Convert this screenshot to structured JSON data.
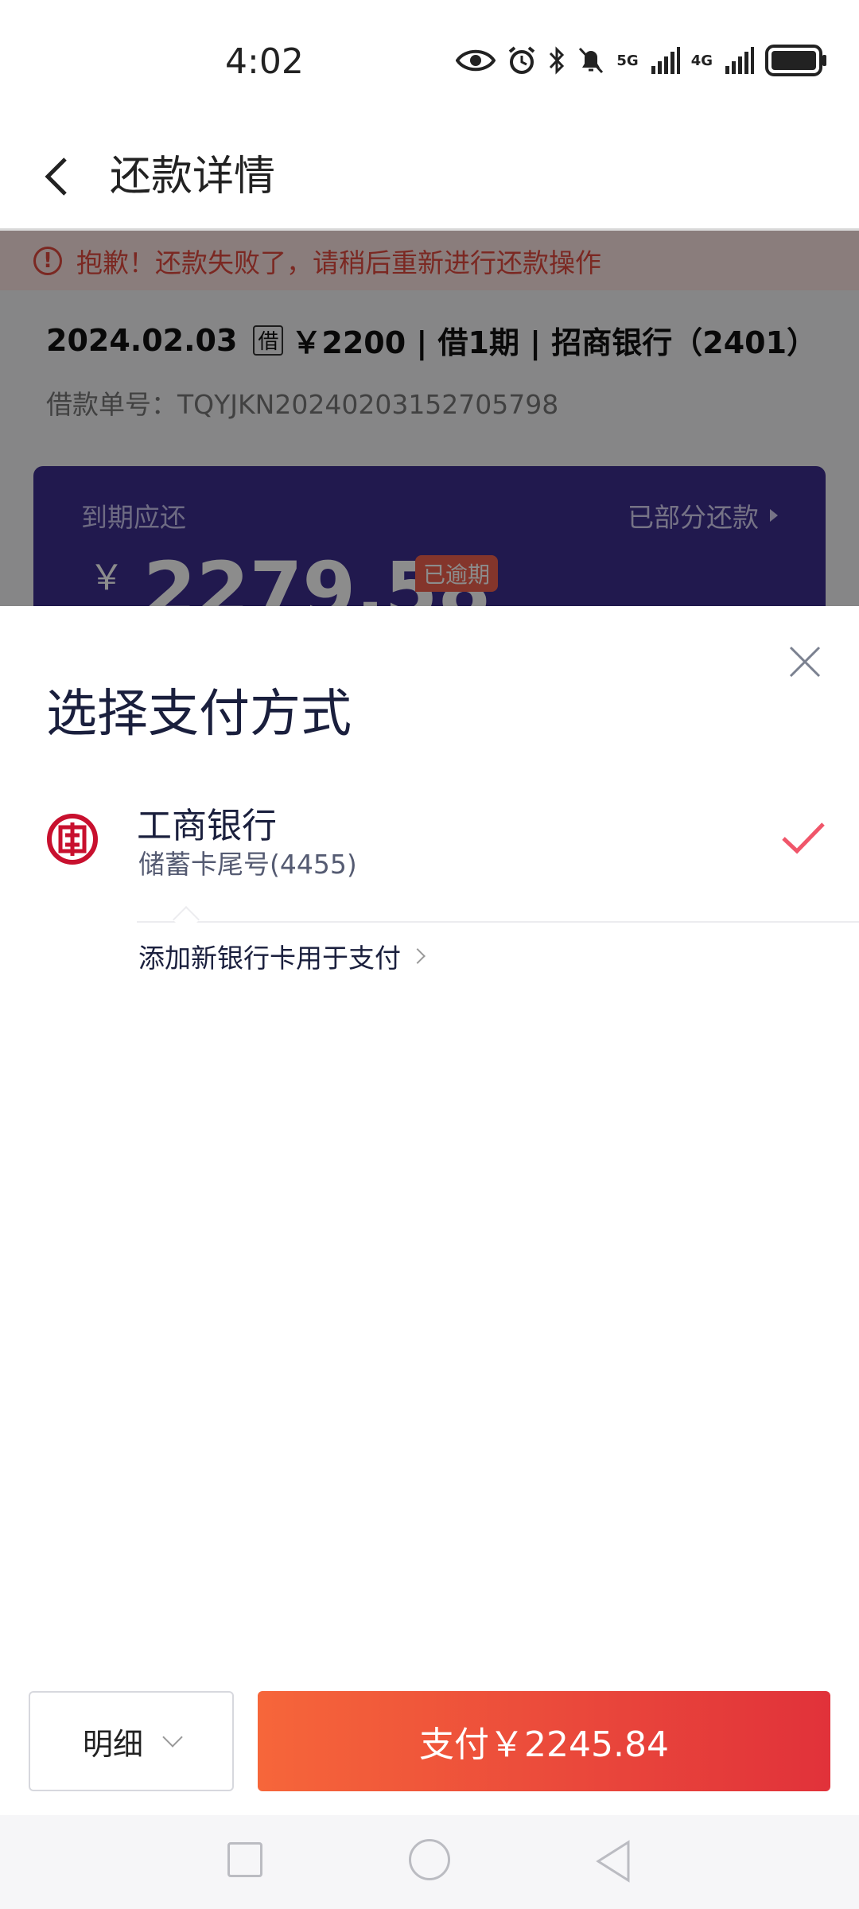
{
  "status_bar": {
    "time": "4:02",
    "network_1": "5G",
    "network_2": "4G"
  },
  "header": {
    "title": "还款详情"
  },
  "background": {
    "error_message": "抱歉！还款失败了，请稍后重新进行还款操作",
    "loan_date": "2024.02.03",
    "loan_tag": "借",
    "loan_summary": "￥2200 | 借1期 | 招商银行（2401）",
    "loan_number": "借款单号：TQYJKN20240203152705798",
    "due_label": "到期应还",
    "partial_link": "已部分还款",
    "currency": "￥",
    "due_amount": "2279.58",
    "overdue_badge": "已逾期"
  },
  "sheet": {
    "title": "选择支付方式",
    "selected_bank": {
      "name": "工商银行",
      "detail": "储蓄卡尾号(4455)"
    },
    "add_card_label": "添加新银行卡用于支付"
  },
  "actions": {
    "detail_label": "明细",
    "pay_label": "支付￥2245.84"
  },
  "colors": {
    "primary_red": "#e9463b",
    "error_red": "#e04a3f",
    "card_purple": "#3c2f8f",
    "check_red": "#f0566a"
  },
  "icons": [
    "eye-icon",
    "alarm-icon",
    "bluetooth-icon",
    "mute-icon",
    "signal-icon",
    "battery-icon",
    "back-arrow-icon",
    "close-icon",
    "icbc-logo-icon",
    "check-icon"
  ]
}
